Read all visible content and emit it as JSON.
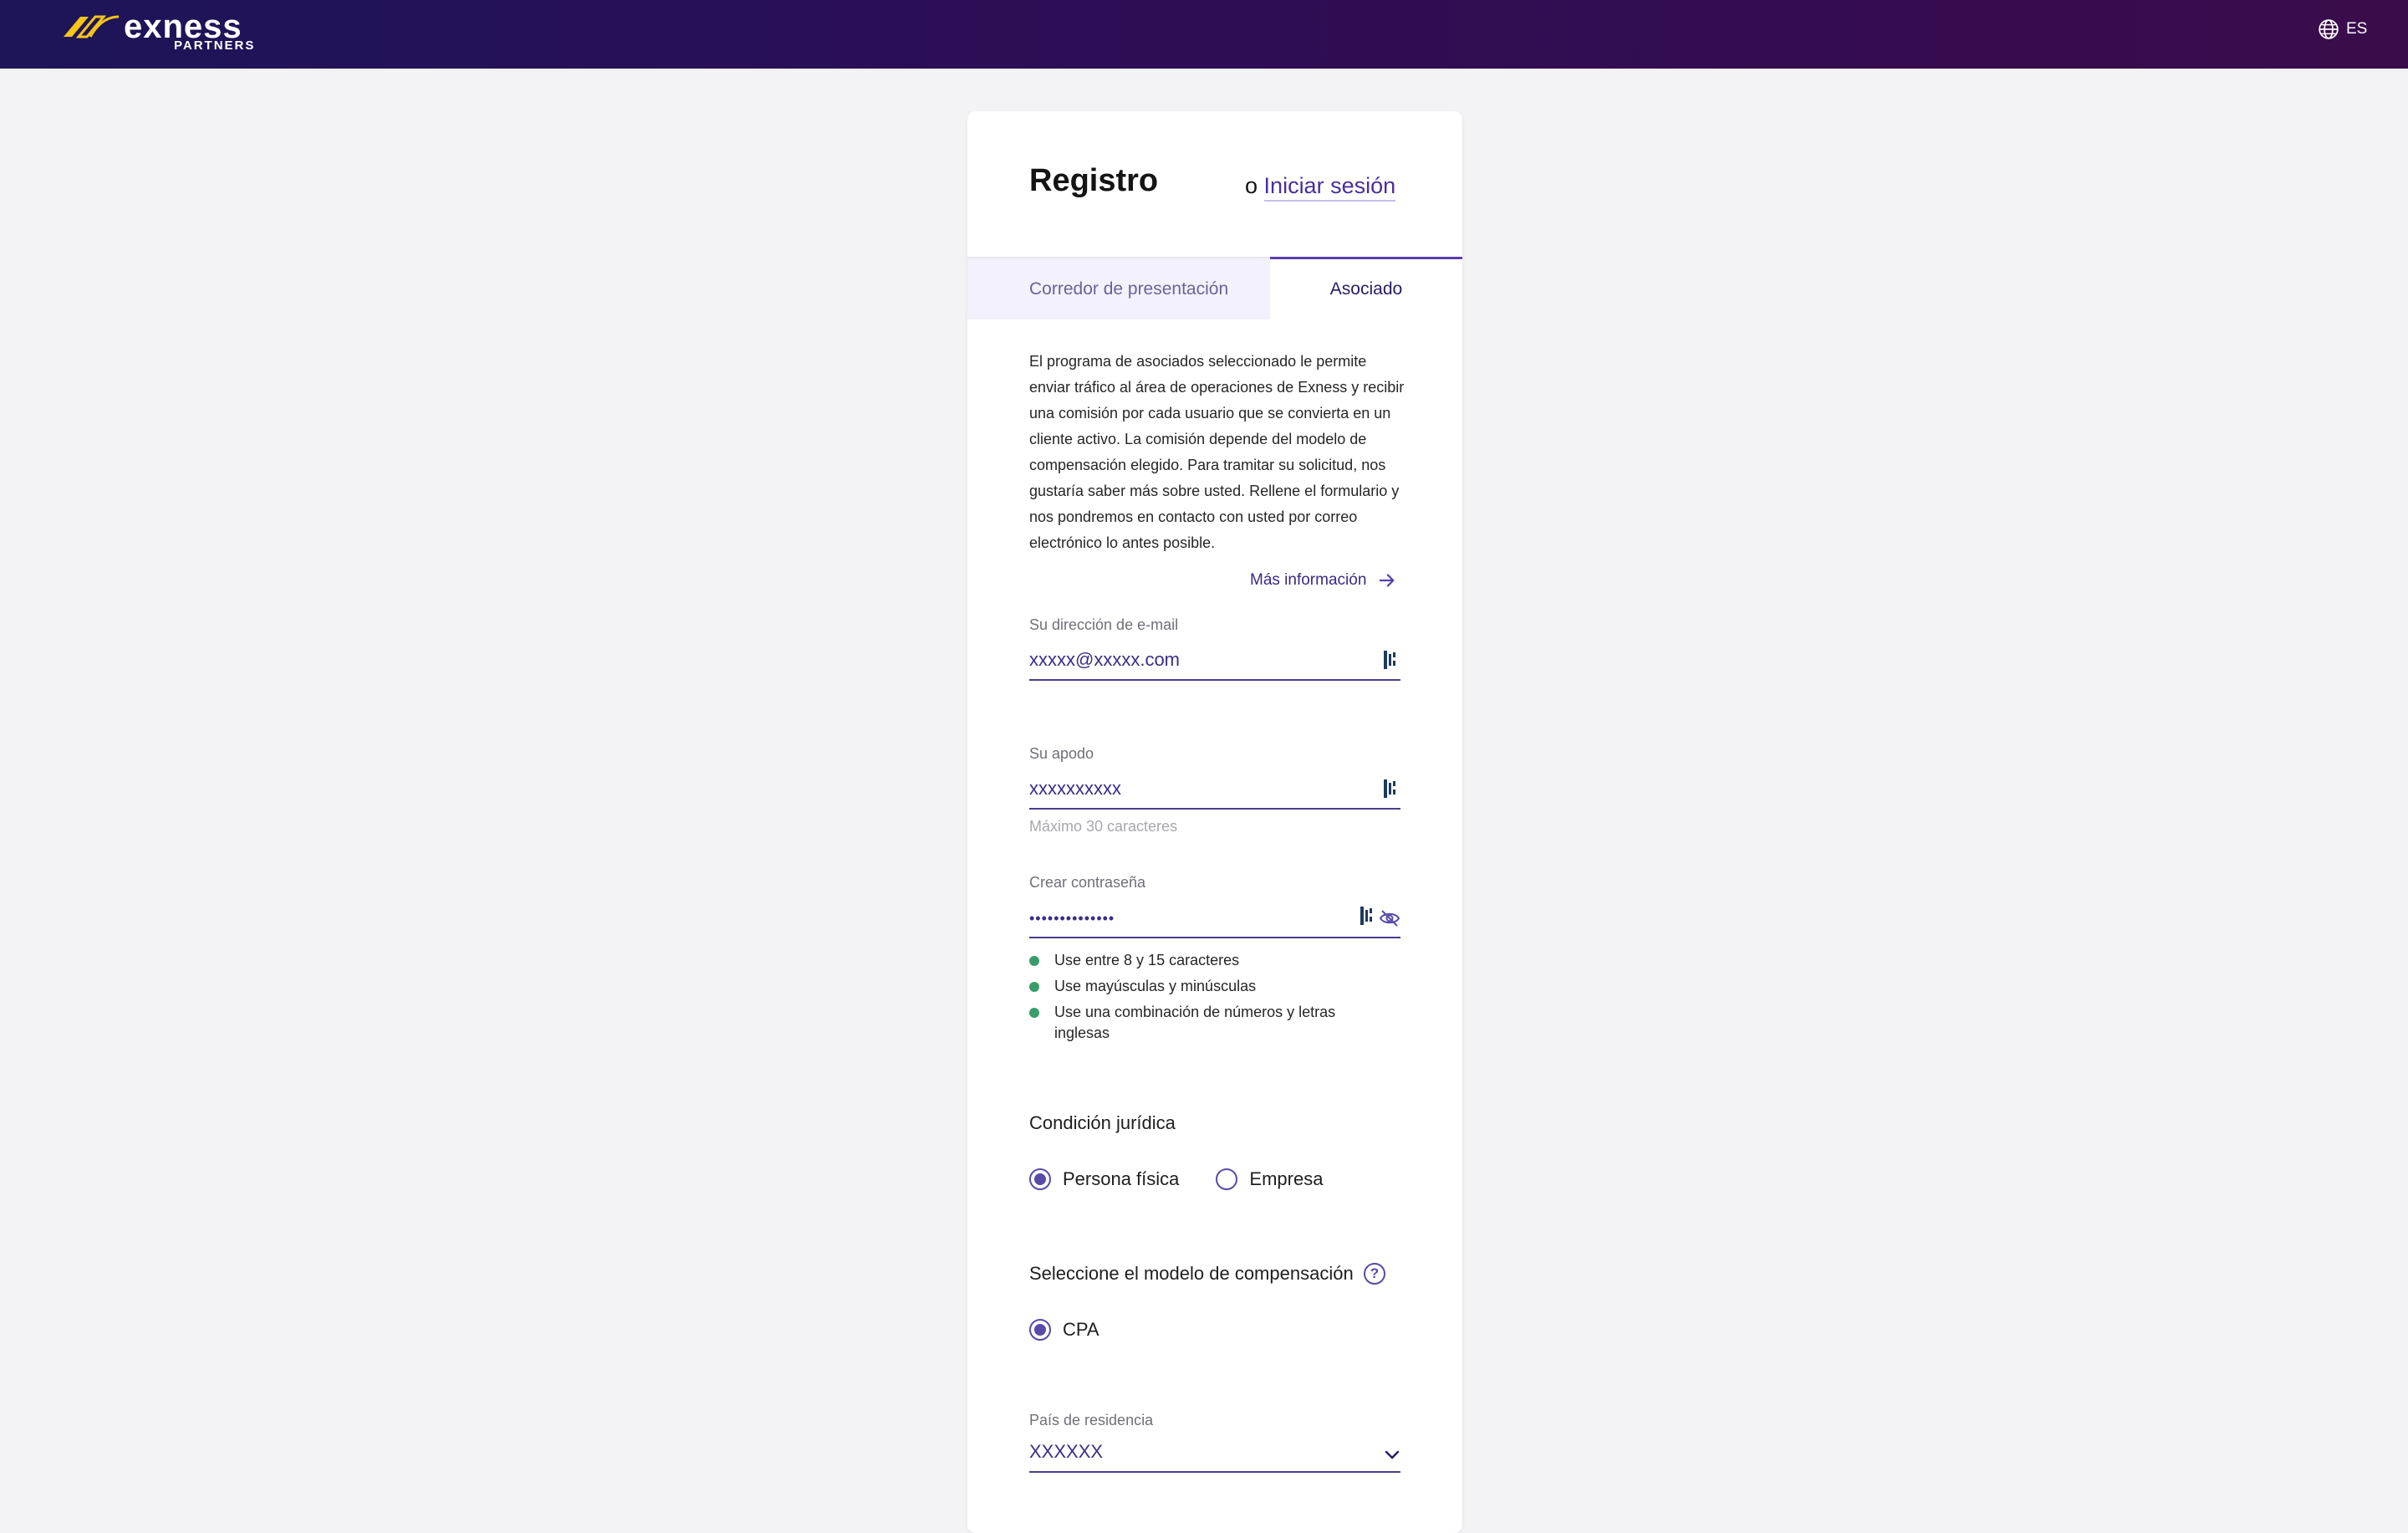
{
  "header": {
    "brand": "exness",
    "brand_sub": "PARTNERS",
    "language": "ES"
  },
  "card": {
    "title": "Registro",
    "login_prefix": "o",
    "login_link": "Iniciar sesión",
    "tabs": [
      {
        "label": "Corredor de presentación",
        "active": false
      },
      {
        "label": "Asociado",
        "active": true
      }
    ],
    "description": "El programa de asociados seleccionado le permite enviar tráfico al área de operaciones de Exness y recibir una comisión por cada usuario que se convierta en un cliente activo. La comisión depende del modelo de compensación elegido. Para tramitar su solicitud, nos gustaría saber más sobre usted. Rellene el formulario y nos pondremos en contacto con usted por correo electrónico lo antes posible.",
    "more_info": "Más información",
    "email": {
      "label": "Su dirección de e-mail",
      "value": "xxxxx@xxxxx.com"
    },
    "nickname": {
      "label": "Su apodo",
      "value": "xxxxxxxxxx",
      "hint": "Máximo 30 caracteres"
    },
    "password": {
      "label": "Crear contraseña",
      "value": "••••••••••••••",
      "rules": [
        "Use entre 8 y 15 caracteres",
        "Use mayúsculas y minúsculas",
        "Use una combinación de números y letras inglesas"
      ]
    },
    "legal": {
      "title": "Condición jurídica",
      "options": [
        {
          "label": "Persona física",
          "selected": true
        },
        {
          "label": "Empresa",
          "selected": false
        }
      ]
    },
    "compensation": {
      "title": "Seleccione el modelo de compensación",
      "help": "?",
      "options": [
        {
          "label": "CPA",
          "selected": true
        }
      ]
    },
    "country": {
      "label": "País de residencia",
      "value": "XXXXXX"
    }
  },
  "colors": {
    "accent": "#5a3fb0",
    "success": "#3a9c6b",
    "logo_mark": "#f5c518"
  }
}
